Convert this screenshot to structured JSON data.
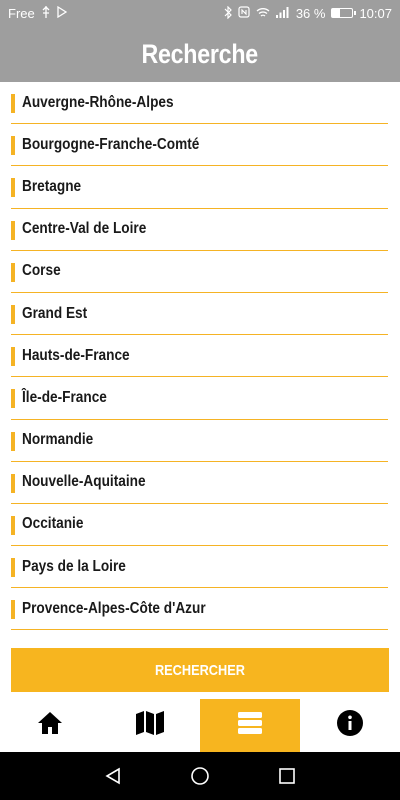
{
  "status_bar": {
    "carrier": "Free",
    "battery_percent": "36 %",
    "battery_level": 0.36,
    "time": "10:07",
    "icons": [
      "usb-icon",
      "notification-icon",
      "bluetooth-icon",
      "nfc-icon",
      "wifi-icon",
      "signal-icon",
      "battery-icon"
    ]
  },
  "header": {
    "title": "Recherche"
  },
  "regions": [
    "Auvergne-Rhône-Alpes",
    "Bourgogne-Franche-Comté",
    "Bretagne",
    "Centre-Val de Loire",
    "Corse",
    "Grand Est",
    "Hauts-de-France",
    "Île-de-France",
    "Normandie",
    "Nouvelle-Aquitaine",
    "Occitanie",
    "Pays de la Loire",
    "Provence-Alpes-Côte d'Azur"
  ],
  "search_button": {
    "label": "RECHERCHER"
  },
  "tab_bar": {
    "tabs": [
      {
        "icon": "home-icon",
        "active": false
      },
      {
        "icon": "map-icon",
        "active": false
      },
      {
        "icon": "list-icon",
        "active": true
      },
      {
        "icon": "info-icon",
        "active": false
      }
    ]
  },
  "colors": {
    "accent": "#f7b51f",
    "header_bg": "#9e9e9e",
    "text": "#1a1a1a"
  }
}
